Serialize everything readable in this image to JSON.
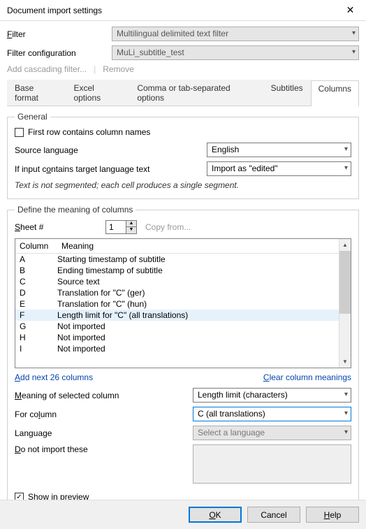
{
  "window": {
    "title": "Document import settings"
  },
  "filter": {
    "label_html": "Filter",
    "select_value": "Multilingual delimited text filter",
    "config_label": "Filter configuration",
    "config_value": "MuLi_subtitle_test"
  },
  "linkbar": {
    "add": "Add cascading filter...",
    "remove": "Remove"
  },
  "tabs": [
    "Base format",
    "Excel options",
    "Comma or tab-separated options",
    "Subtitles",
    "Columns"
  ],
  "active_tab": "Columns",
  "general": {
    "legend": "General",
    "first_row": "First row contains column names",
    "first_row_checked": false,
    "src_label": "Source language",
    "src_value": "English",
    "target_label": "If input contains target language text",
    "target_value": "Import as \"edited\"",
    "note": "Text is not segmented; each cell produces a single segment."
  },
  "define": {
    "legend": "Define the meaning of columns",
    "sheet_label": "Sheet #",
    "sheet_value": "1",
    "copy_from": "Copy from...",
    "headers": {
      "col": "Column",
      "meaning": "Meaning"
    },
    "rows": [
      {
        "c": "A",
        "m": "Starting timestamp of subtitle"
      },
      {
        "c": "B",
        "m": "Ending timestamp of subtitle"
      },
      {
        "c": "C",
        "m": "Source text"
      },
      {
        "c": "D",
        "m": "Translation for \"C\" (ger)"
      },
      {
        "c": "E",
        "m": "Translation for \"C\" (hun)"
      },
      {
        "c": "F",
        "m": "Length limit for \"C\" (all translations)"
      },
      {
        "c": "G",
        "m": "Not imported"
      },
      {
        "c": "H",
        "m": "Not imported"
      },
      {
        "c": "I",
        "m": "Not imported"
      }
    ],
    "selected": "F",
    "add_next": "Add next 26 columns",
    "clear": "Clear column meanings",
    "meaning_label": "Meaning of selected column",
    "meaning_value": "Length limit (characters)",
    "forcol_label": "For column",
    "forcol_value": "C (all translations)",
    "lang_label": "Language",
    "lang_value": "Select a language",
    "dni_label": "Do not import these",
    "show_preview": "Show in preview",
    "show_preview_checked": true
  },
  "footer": {
    "ok": "OK",
    "cancel": "Cancel",
    "help": "Help"
  }
}
